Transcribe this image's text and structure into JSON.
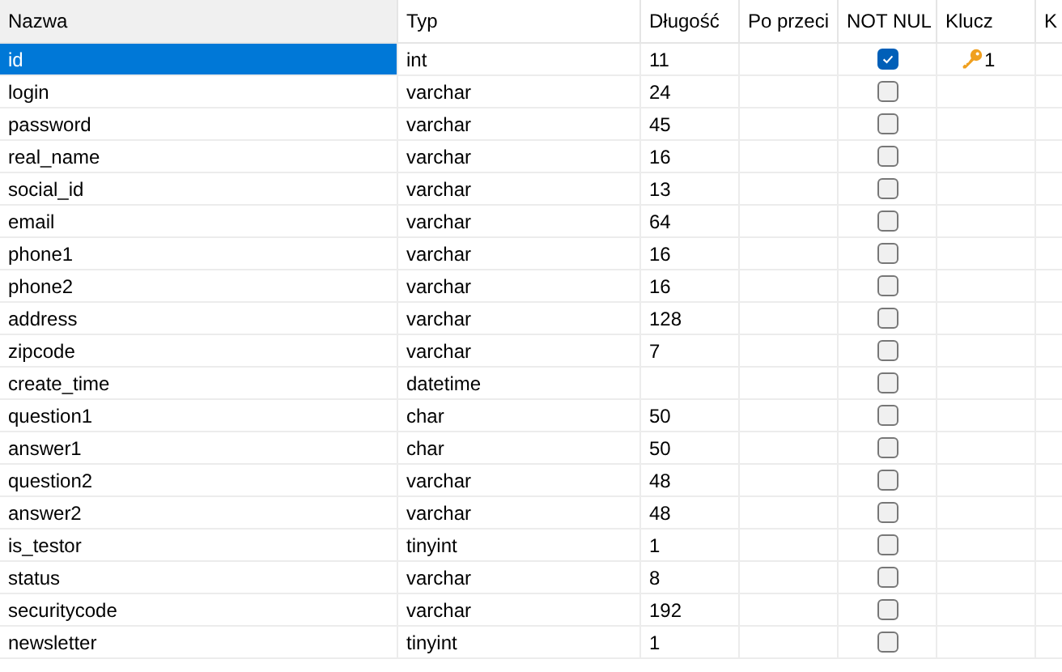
{
  "table": {
    "columns": [
      {
        "label": "Nazwa",
        "highlighted": true
      },
      {
        "label": "Typ",
        "highlighted": false
      },
      {
        "label": "Długość",
        "highlighted": false
      },
      {
        "label": "Po przeci",
        "highlighted": false
      },
      {
        "label": "NOT NUL",
        "highlighted": false
      },
      {
        "label": "Klucz",
        "highlighted": false
      },
      {
        "label": "K",
        "highlighted": false
      }
    ],
    "rows": [
      {
        "name": "id",
        "type": "int",
        "length": "11",
        "not_null": true,
        "key": "1",
        "selected": true
      },
      {
        "name": "login",
        "type": "varchar",
        "length": "24",
        "not_null": false,
        "selected": false
      },
      {
        "name": "password",
        "type": "varchar",
        "length": "45",
        "not_null": false,
        "selected": false
      },
      {
        "name": "real_name",
        "type": "varchar",
        "length": "16",
        "not_null": false,
        "selected": false
      },
      {
        "name": "social_id",
        "type": "varchar",
        "length": "13",
        "not_null": false,
        "selected": false
      },
      {
        "name": "email",
        "type": "varchar",
        "length": "64",
        "not_null": false,
        "selected": false
      },
      {
        "name": "phone1",
        "type": "varchar",
        "length": "16",
        "not_null": false,
        "selected": false
      },
      {
        "name": "phone2",
        "type": "varchar",
        "length": "16",
        "not_null": false,
        "selected": false
      },
      {
        "name": "address",
        "type": "varchar",
        "length": "128",
        "not_null": false,
        "selected": false
      },
      {
        "name": "zipcode",
        "type": "varchar",
        "length": "7",
        "not_null": false,
        "selected": false
      },
      {
        "name": "create_time",
        "type": "datetime",
        "not_null": false,
        "selected": false
      },
      {
        "name": "question1",
        "type": "char",
        "length": "50",
        "not_null": false,
        "selected": false
      },
      {
        "name": "answer1",
        "type": "char",
        "length": "50",
        "not_null": false,
        "selected": false
      },
      {
        "name": "question2",
        "type": "varchar",
        "length": "48",
        "not_null": false,
        "selected": false
      },
      {
        "name": "answer2",
        "type": "varchar",
        "length": "48",
        "not_null": false,
        "selected": false
      },
      {
        "name": "is_testor",
        "type": "tinyint",
        "length": "1",
        "not_null": false,
        "selected": false
      },
      {
        "name": "status",
        "type": "varchar",
        "length": "8",
        "not_null": false,
        "selected": false
      },
      {
        "name": "securitycode",
        "type": "varchar",
        "length": "192",
        "not_null": false,
        "selected": false
      },
      {
        "name": "newsletter",
        "type": "tinyint",
        "length": "1",
        "not_null": false,
        "selected": false
      }
    ]
  }
}
